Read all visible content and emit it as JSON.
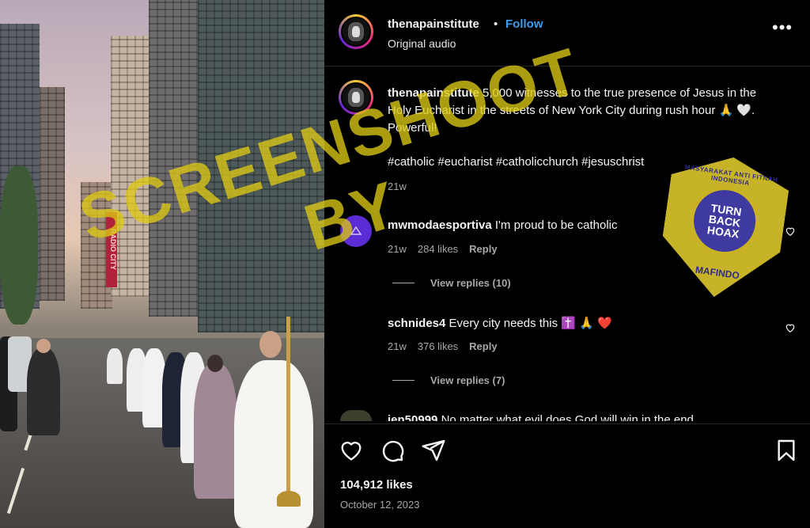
{
  "post": {
    "username": "thenapainstitute",
    "separator": "•",
    "follow_label": "Follow",
    "audio": "Original audio",
    "more_label": "•••",
    "caption_user": "thenapainstitute",
    "caption_text": "5,000 witnesses to the true presence of Jesus in the Holy Eucharist in the streets of New York City during rush hour 🙏 🤍. Powerful!",
    "hashtags": "#catholic #eucharist #catholicchurch #jesuschrist",
    "caption_age": "21w",
    "likes": "104,912 likes",
    "date": "October 12, 2023"
  },
  "comments": [
    {
      "user": "mwmodaesportiva",
      "text": "I'm proud to be catholic",
      "age": "21w",
      "likes": "284 likes",
      "reply_label": "Reply",
      "view_replies": "View replies (10)"
    },
    {
      "user": "schnides4",
      "text": "Every city needs this ✝️ 🙏 ❤️",
      "age": "21w",
      "likes": "376 likes",
      "reply_label": "Reply",
      "view_replies": "View replies (7)"
    },
    {
      "user": "jen50999",
      "text": "No matter what evil does God will win in the end"
    }
  ],
  "overlay": {
    "watermark": "SCREENSHOOT BY",
    "stamp_ring": "MASYARAKAT ANTI FITNAH INDONESIA",
    "stamp_line1": "TURN",
    "stamp_line2": "BACK",
    "stamp_line3": "HOAX",
    "stamp_bottom": "MAFINDO"
  },
  "photo": {
    "sign_text": "RADIO CITY"
  },
  "colors": {
    "follow": "#3b9cf0",
    "background": "#000000",
    "watermark": "#dcc814",
    "stamp": "#d8c22a"
  },
  "icons": [
    "heart-icon",
    "comment-icon",
    "share-icon",
    "bookmark-icon",
    "more-icon"
  ]
}
